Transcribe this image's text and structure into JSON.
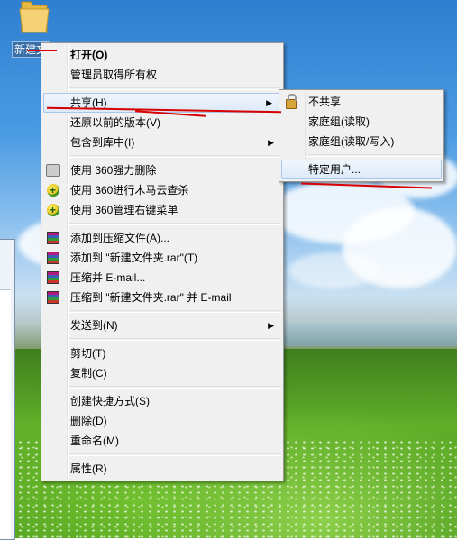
{
  "desktop": {
    "folder_label": "新建文"
  },
  "context_menu": {
    "items": [
      {
        "label": "打开(O)",
        "bold": true
      },
      {
        "label": "管理员取得所有权"
      },
      {
        "label": "共享(H)",
        "submenu": true
      },
      {
        "label": "还原以前的版本(V)"
      },
      {
        "label": "包含到库中(I)",
        "submenu": true
      },
      {
        "label": "使用 360强力删除",
        "icon": "360-shredder-icon"
      },
      {
        "label": "使用 360进行木马云查杀",
        "icon": "360-security-icon"
      },
      {
        "label": "使用 360管理右键菜单",
        "icon": "360-security-icon"
      },
      {
        "label": "添加到压缩文件(A)...",
        "icon": "winrar-icon"
      },
      {
        "label": "添加到 \"新建文件夹.rar\"(T)",
        "icon": "winrar-icon"
      },
      {
        "label": "压缩并 E-mail...",
        "icon": "winrar-icon"
      },
      {
        "label": "压缩到 \"新建文件夹.rar\" 并 E-mail",
        "icon": "winrar-icon"
      },
      {
        "label": "发送到(N)",
        "submenu": true
      },
      {
        "label": "剪切(T)"
      },
      {
        "label": "复制(C)"
      },
      {
        "label": "创建快捷方式(S)"
      },
      {
        "label": "删除(D)"
      },
      {
        "label": "重命名(M)"
      },
      {
        "label": "属性(R)"
      }
    ]
  },
  "share_submenu": {
    "items": [
      {
        "label": "不共享",
        "icon": "lock-icon"
      },
      {
        "label": "家庭组(读取)"
      },
      {
        "label": "家庭组(读取/写入)"
      },
      {
        "label": "特定用户..."
      }
    ]
  },
  "colors": {
    "menu_bg": "#f0f0f0",
    "hover_border": "#a8c7ec",
    "annotation_red": "#d80000"
  }
}
